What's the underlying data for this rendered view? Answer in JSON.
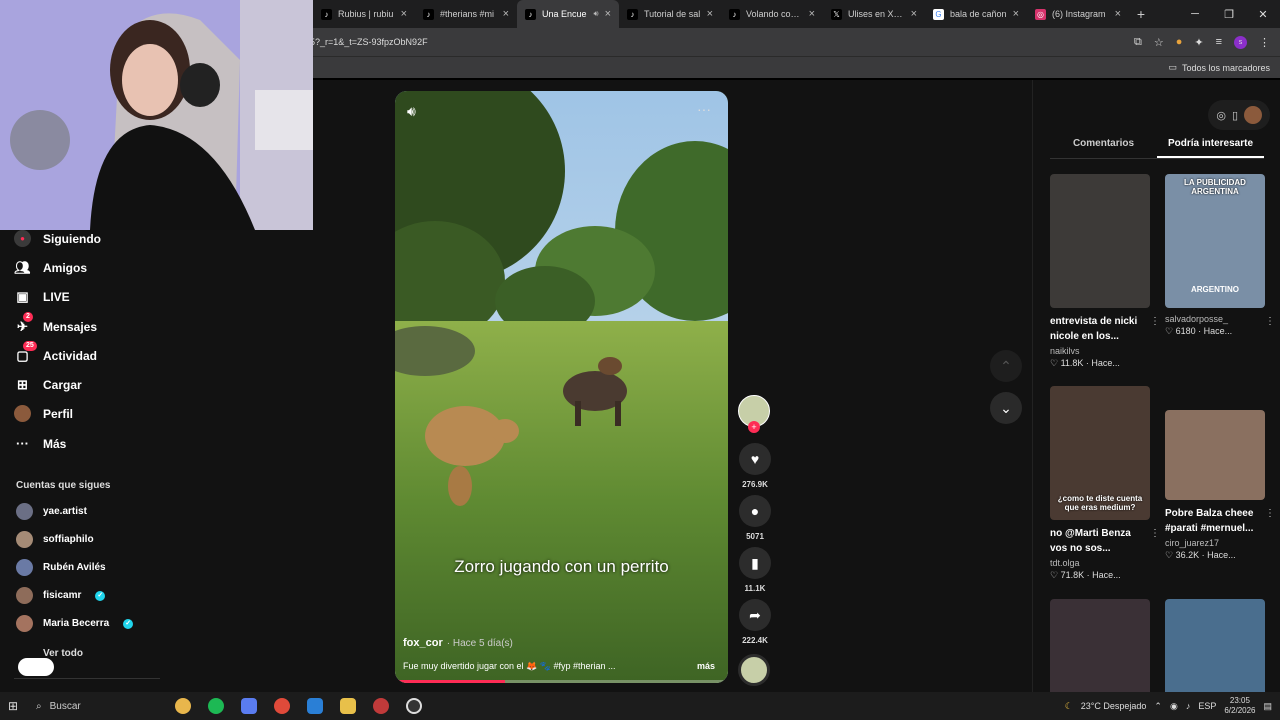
{
  "browser": {
    "tabs": [
      {
        "title": "Rubius | rubiu",
        "fav": "tiktok"
      },
      {
        "title": "#therians #mi",
        "fav": "tiktok"
      },
      {
        "title": "Una Encue",
        "fav": "tiktok",
        "active": true
      },
      {
        "title": "Tutorial de sal",
        "fav": "tiktok"
      },
      {
        "title": "Volando con R",
        "fav": "tiktok"
      },
      {
        "title": "Ulises en X: \"E",
        "fav": "x"
      },
      {
        "title": "bala de cañon",
        "fav": "google"
      },
      {
        "title": "(6) Instagram",
        "fav": "instagram"
      }
    ],
    "url": "5?_r=1&_t=ZS-93fpzObN92F",
    "bookmarks_label": "Todos los marcadores"
  },
  "sidebar": {
    "items": [
      {
        "label": "Siguiendo",
        "icon": "following-icon"
      },
      {
        "label": "Amigos",
        "icon": "friends-icon"
      },
      {
        "label": "LIVE",
        "icon": "live-icon"
      },
      {
        "label": "Mensajes",
        "icon": "messages-icon",
        "badge": "2"
      },
      {
        "label": "Actividad",
        "icon": "activity-icon",
        "badge": "25"
      },
      {
        "label": "Cargar",
        "icon": "upload-icon"
      },
      {
        "label": "Perfil",
        "icon": "profile-icon"
      },
      {
        "label": "Más",
        "icon": "more-icon"
      }
    ],
    "following_title": "Cuentas que sigues",
    "following": [
      {
        "name": "yae.artist",
        "verified": false,
        "color": "#6b6f85"
      },
      {
        "name": "soffiaphilo",
        "verified": false,
        "color": "#a58b76"
      },
      {
        "name": "Rubén Avilés",
        "verified": false,
        "color": "#6a7aa5"
      },
      {
        "name": "fisicamr",
        "verified": true,
        "color": "#8e6c5a"
      },
      {
        "name": "Maria Becerra",
        "verified": true,
        "color": "#a4735f"
      }
    ],
    "see_all": "Ver todo"
  },
  "video": {
    "caption": "Zorro jugando con un perrito",
    "author": "fox_cor",
    "ago": "· Hace 5 día(s)",
    "description": "Fue muy divertido jugar con el 🦊 🐾 #fyp #therian ...",
    "more": "más",
    "progress": 0.33
  },
  "actions": {
    "likes": "276.9K",
    "comments": "5071",
    "saves": "11.1K",
    "shares": "222.4K"
  },
  "right": {
    "tabs": [
      "Comentarios",
      "Podría interesarte"
    ],
    "active_tab": 1,
    "cards": [
      {
        "title": "entrevista de nicki nicole en los...",
        "user": "naikilvs",
        "stats": "♡ 11.8K · Hace...",
        "thumb_text": "",
        "bg": "#3d3a38"
      },
      {
        "title": "",
        "user": "salvadorposse_",
        "stats": "♡ 6180 · Hace...",
        "thumb_text": "LA PUBLICIDAD ARGENTINA",
        "thumb_text2": "ARGENTINO",
        "bg": "#7a8fa6"
      },
      {
        "title": "no @Marti Benza vos no sos...",
        "user": "tdt.olga",
        "stats": "♡ 71.8K · Hace...",
        "thumb_text": "¿como te diste cuenta que eras medium?",
        "bg": "#4a3a32"
      },
      {
        "title": "Pobre Balza cheee #parati #mernuel...",
        "user": "ciro_juarez17",
        "stats": "♡ 36.2K · Hace...",
        "thumb_text": "",
        "bg": "#8a7060"
      },
      {
        "title": "",
        "user": "",
        "stats": "",
        "thumb_text": "",
        "bg": "#3a3036"
      },
      {
        "title": "",
        "user": "",
        "stats": "",
        "thumb_text": "",
        "bg": "#4a6e8e"
      }
    ]
  },
  "taskbar": {
    "search": "Buscar",
    "weather": "23°C  Despejado",
    "lang": "ESP",
    "time": "23:05",
    "date": "6/2/2026"
  }
}
